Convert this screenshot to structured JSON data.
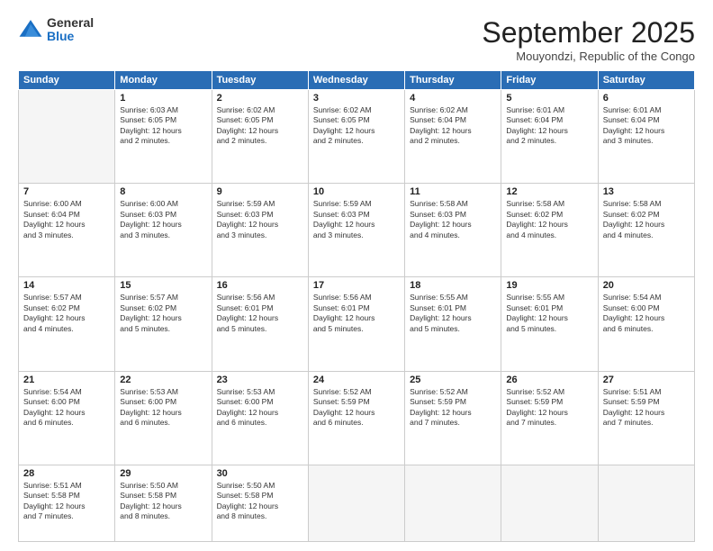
{
  "logo": {
    "general": "General",
    "blue": "Blue"
  },
  "title": "September 2025",
  "subtitle": "Mouyondzi, Republic of the Congo",
  "days_of_week": [
    "Sunday",
    "Monday",
    "Tuesday",
    "Wednesday",
    "Thursday",
    "Friday",
    "Saturday"
  ],
  "weeks": [
    [
      {
        "day": "",
        "info": ""
      },
      {
        "day": "1",
        "info": "Sunrise: 6:03 AM\nSunset: 6:05 PM\nDaylight: 12 hours\nand 2 minutes."
      },
      {
        "day": "2",
        "info": "Sunrise: 6:02 AM\nSunset: 6:05 PM\nDaylight: 12 hours\nand 2 minutes."
      },
      {
        "day": "3",
        "info": "Sunrise: 6:02 AM\nSunset: 6:05 PM\nDaylight: 12 hours\nand 2 minutes."
      },
      {
        "day": "4",
        "info": "Sunrise: 6:02 AM\nSunset: 6:04 PM\nDaylight: 12 hours\nand 2 minutes."
      },
      {
        "day": "5",
        "info": "Sunrise: 6:01 AM\nSunset: 6:04 PM\nDaylight: 12 hours\nand 2 minutes."
      },
      {
        "day": "6",
        "info": "Sunrise: 6:01 AM\nSunset: 6:04 PM\nDaylight: 12 hours\nand 3 minutes."
      }
    ],
    [
      {
        "day": "7",
        "info": "Sunrise: 6:00 AM\nSunset: 6:04 PM\nDaylight: 12 hours\nand 3 minutes."
      },
      {
        "day": "8",
        "info": "Sunrise: 6:00 AM\nSunset: 6:03 PM\nDaylight: 12 hours\nand 3 minutes."
      },
      {
        "day": "9",
        "info": "Sunrise: 5:59 AM\nSunset: 6:03 PM\nDaylight: 12 hours\nand 3 minutes."
      },
      {
        "day": "10",
        "info": "Sunrise: 5:59 AM\nSunset: 6:03 PM\nDaylight: 12 hours\nand 3 minutes."
      },
      {
        "day": "11",
        "info": "Sunrise: 5:58 AM\nSunset: 6:03 PM\nDaylight: 12 hours\nand 4 minutes."
      },
      {
        "day": "12",
        "info": "Sunrise: 5:58 AM\nSunset: 6:02 PM\nDaylight: 12 hours\nand 4 minutes."
      },
      {
        "day": "13",
        "info": "Sunrise: 5:58 AM\nSunset: 6:02 PM\nDaylight: 12 hours\nand 4 minutes."
      }
    ],
    [
      {
        "day": "14",
        "info": "Sunrise: 5:57 AM\nSunset: 6:02 PM\nDaylight: 12 hours\nand 4 minutes."
      },
      {
        "day": "15",
        "info": "Sunrise: 5:57 AM\nSunset: 6:02 PM\nDaylight: 12 hours\nand 5 minutes."
      },
      {
        "day": "16",
        "info": "Sunrise: 5:56 AM\nSunset: 6:01 PM\nDaylight: 12 hours\nand 5 minutes."
      },
      {
        "day": "17",
        "info": "Sunrise: 5:56 AM\nSunset: 6:01 PM\nDaylight: 12 hours\nand 5 minutes."
      },
      {
        "day": "18",
        "info": "Sunrise: 5:55 AM\nSunset: 6:01 PM\nDaylight: 12 hours\nand 5 minutes."
      },
      {
        "day": "19",
        "info": "Sunrise: 5:55 AM\nSunset: 6:01 PM\nDaylight: 12 hours\nand 5 minutes."
      },
      {
        "day": "20",
        "info": "Sunrise: 5:54 AM\nSunset: 6:00 PM\nDaylight: 12 hours\nand 6 minutes."
      }
    ],
    [
      {
        "day": "21",
        "info": "Sunrise: 5:54 AM\nSunset: 6:00 PM\nDaylight: 12 hours\nand 6 minutes."
      },
      {
        "day": "22",
        "info": "Sunrise: 5:53 AM\nSunset: 6:00 PM\nDaylight: 12 hours\nand 6 minutes."
      },
      {
        "day": "23",
        "info": "Sunrise: 5:53 AM\nSunset: 6:00 PM\nDaylight: 12 hours\nand 6 minutes."
      },
      {
        "day": "24",
        "info": "Sunrise: 5:52 AM\nSunset: 5:59 PM\nDaylight: 12 hours\nand 6 minutes."
      },
      {
        "day": "25",
        "info": "Sunrise: 5:52 AM\nSunset: 5:59 PM\nDaylight: 12 hours\nand 7 minutes."
      },
      {
        "day": "26",
        "info": "Sunrise: 5:52 AM\nSunset: 5:59 PM\nDaylight: 12 hours\nand 7 minutes."
      },
      {
        "day": "27",
        "info": "Sunrise: 5:51 AM\nSunset: 5:59 PM\nDaylight: 12 hours\nand 7 minutes."
      }
    ],
    [
      {
        "day": "28",
        "info": "Sunrise: 5:51 AM\nSunset: 5:58 PM\nDaylight: 12 hours\nand 7 minutes."
      },
      {
        "day": "29",
        "info": "Sunrise: 5:50 AM\nSunset: 5:58 PM\nDaylight: 12 hours\nand 8 minutes."
      },
      {
        "day": "30",
        "info": "Sunrise: 5:50 AM\nSunset: 5:58 PM\nDaylight: 12 hours\nand 8 minutes."
      },
      {
        "day": "",
        "info": ""
      },
      {
        "day": "",
        "info": ""
      },
      {
        "day": "",
        "info": ""
      },
      {
        "day": "",
        "info": ""
      }
    ]
  ]
}
